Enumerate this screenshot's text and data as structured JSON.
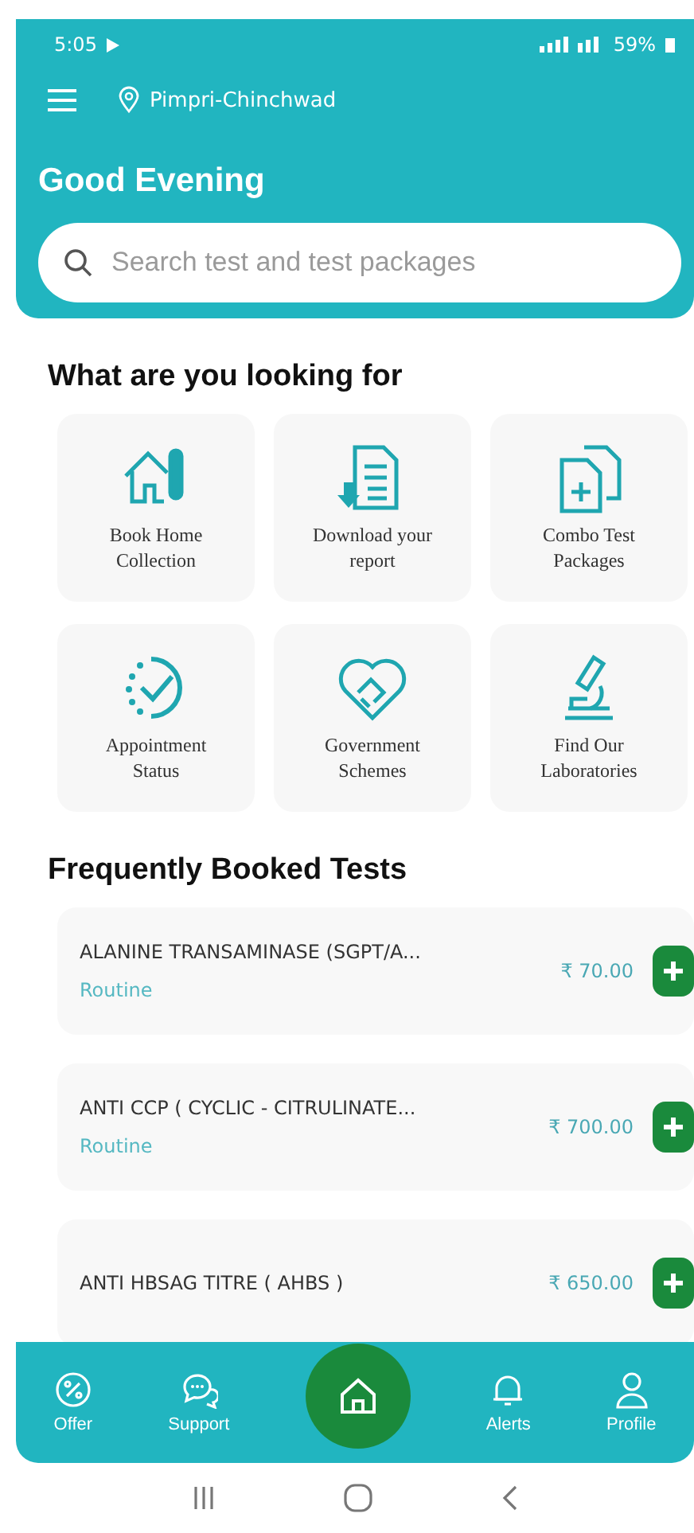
{
  "status_bar": {
    "time": "5:05",
    "battery": "59%"
  },
  "header": {
    "location": "Pimpri-Chinchwad",
    "greeting": "Good Evening",
    "search": {
      "placeholder": "Search test and test packages"
    }
  },
  "services": {
    "title": "What are you looking for",
    "items": [
      {
        "kind": "home",
        "label": "Book Home Collection"
      },
      {
        "kind": "report",
        "label": "Download your report"
      },
      {
        "kind": "combo",
        "label": "Combo Test Packages"
      },
      {
        "kind": "status",
        "label": "Appointment Status"
      },
      {
        "kind": "schemes",
        "label": "Government Schemes"
      },
      {
        "kind": "lab",
        "label": "Find Our Laboratories"
      }
    ]
  },
  "tests": {
    "title": "Frequently Booked Tests",
    "items": [
      {
        "name": "ALANINE TRANSAMINASE (SGPT/A...",
        "tag": "Routine",
        "price": "₹ 70.00"
      },
      {
        "name": "ANTI CCP ( CYCLIC - CITRULINATE...",
        "tag": "Routine",
        "price": "₹ 700.00"
      },
      {
        "name": "ANTI HBSAG TITRE ( AHBS )",
        "price": "₹ 650.00"
      }
    ]
  },
  "bottom_nav": [
    {
      "kind": "offer",
      "label": "Offer"
    },
    {
      "kind": "support",
      "label": "Support"
    },
    {
      "kind": "home"
    },
    {
      "kind": "alerts",
      "label": "Alerts"
    },
    {
      "kind": "profile",
      "label": "Profile"
    }
  ]
}
